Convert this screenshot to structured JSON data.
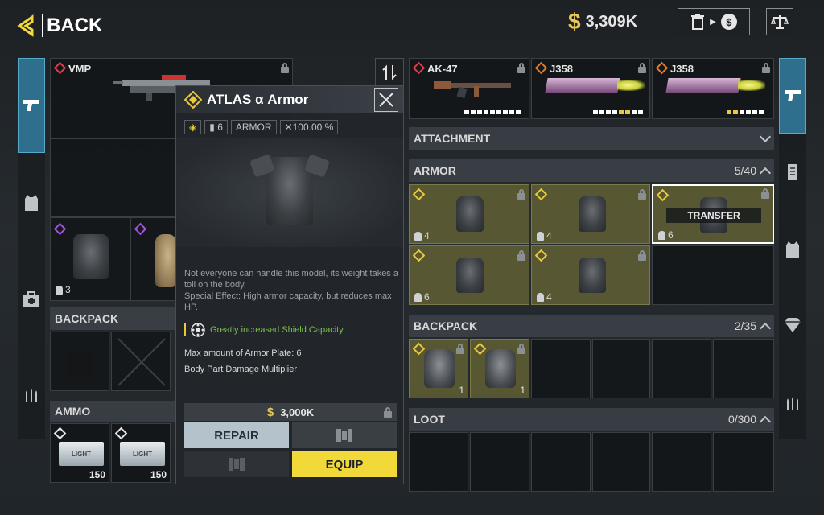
{
  "header": {
    "back_label": "BACK",
    "currency": "3,309K",
    "currency_symbol": "$",
    "sell_icon": "trash-to-cash-icon",
    "scale_icon": "balance-scale-icon"
  },
  "left_panel": {
    "weapon_name": "VMP",
    "armor_plates": "3",
    "backpack_label": "BACKPACK",
    "ammo_label": "AMMO",
    "ammo_items": [
      {
        "name": "LIGHT",
        "count": "150"
      },
      {
        "name": "LIGHT",
        "count": "150"
      }
    ]
  },
  "popup": {
    "title": "ATLAS α Armor",
    "tags": [
      "6",
      "ARMOR",
      "100.00 %"
    ],
    "description": "Not everyone can handle this model, its weight takes a toll on the body.",
    "special_effect": "Special Effect: High armor capacity, but reduces max HP.",
    "perk": "Greatly increased Shield Capacity",
    "stat_1": "Max amount of Armor Plate: 6",
    "stat_2": "Body Part Damage Multiplier",
    "price": "3,000K",
    "repair_label": "REPAIR",
    "equip_label": "EQUIP",
    "colors": {
      "equip": "#f2d93a",
      "repair": "#b4c3cb",
      "perk": "#7cc04a"
    }
  },
  "right_panel": {
    "weapons": [
      {
        "name": "AK-47",
        "rarity": "red"
      },
      {
        "name": "J358",
        "rarity": "orange"
      },
      {
        "name": "J358",
        "rarity": "orange"
      }
    ],
    "attachment_label": "ATTACHMENT",
    "armor_label": "ARMOR",
    "armor_count": "5/40",
    "armor_items": [
      "4",
      "4",
      "6",
      "6",
      "4"
    ],
    "transfer_label": "TRANSFER",
    "backpack_label": "BACKPACK",
    "backpack_count": "2/35",
    "backpack_items": [
      "1",
      "1"
    ],
    "loot_label": "LOOT",
    "loot_count": "0/300"
  }
}
